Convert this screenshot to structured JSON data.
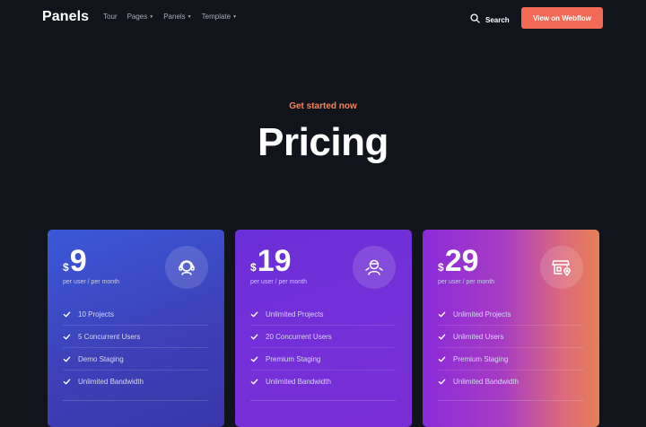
{
  "nav": {
    "logo": "Panels",
    "links": [
      {
        "label": "Tour",
        "dropdown": false
      },
      {
        "label": "Pages",
        "dropdown": true
      },
      {
        "label": "Panels",
        "dropdown": true
      },
      {
        "label": "Template",
        "dropdown": true
      }
    ],
    "search_label": "Search",
    "cta_label": "View on Webflow"
  },
  "hero": {
    "eyebrow": "Get started now",
    "title": "Pricing"
  },
  "plans": [
    {
      "currency": "$",
      "price": "9",
      "per": "per user / per month",
      "icon": "headset-support-icon",
      "features": [
        "10 Projects",
        "5 Concurrent Users",
        "Demo Staging",
        "Unlimited Bandwidth"
      ]
    },
    {
      "currency": "$",
      "price": "19",
      "per": "per user / per month",
      "icon": "team-user-icon",
      "features": [
        "Unlimited Projects",
        "20 Concurrent Users",
        "Premium Staging",
        "Unlimited Bandwidth"
      ]
    },
    {
      "currency": "$",
      "price": "29",
      "per": "per user / per month",
      "icon": "storefront-location-icon",
      "features": [
        "Unlimited Projects",
        "Unlimited Users",
        "Premium Staging",
        "Unlimited Bandwidth"
      ]
    }
  ],
  "colors": {
    "background": "#12141b",
    "accent": "#f26a56",
    "eyebrow": "#f2855e"
  }
}
